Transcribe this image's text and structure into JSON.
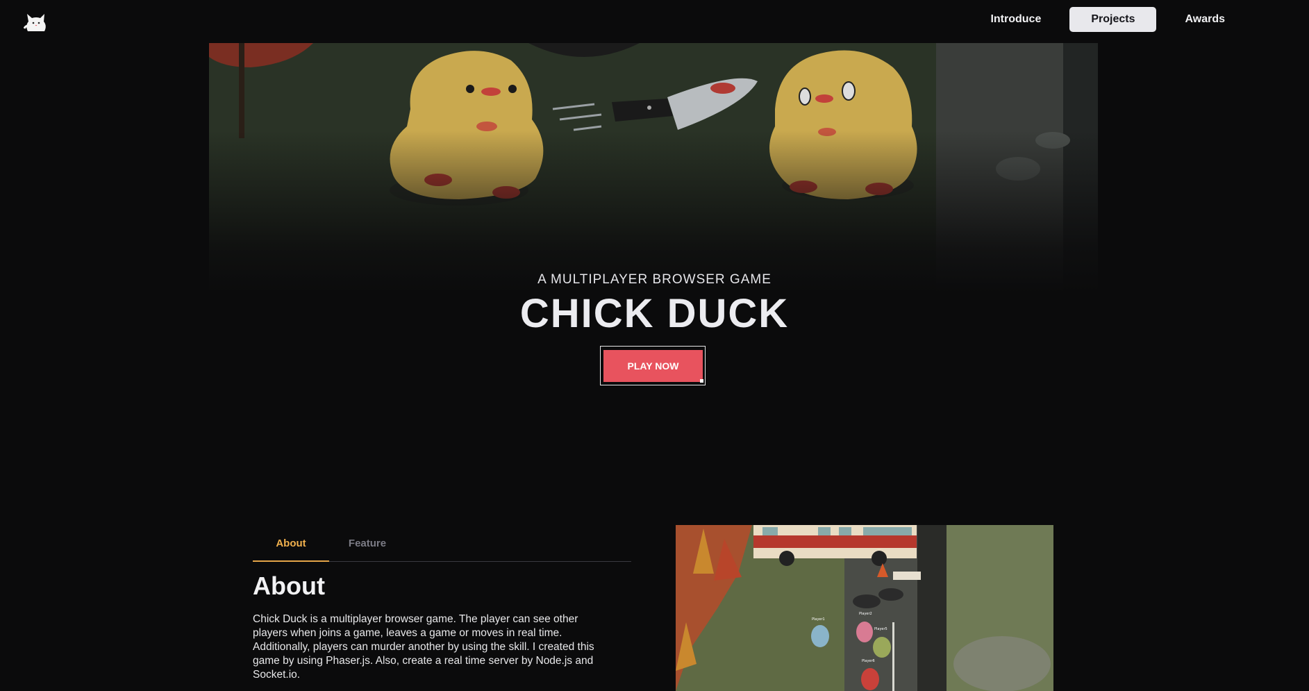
{
  "nav": {
    "links": [
      {
        "label": "Introduce"
      },
      {
        "label": "Projects"
      },
      {
        "label": "Awards"
      }
    ]
  },
  "hero": {
    "subtitle": "A MULTIPLAYER BROWSER GAME",
    "title": "CHICK DUCK",
    "play_label": "PLAY NOW"
  },
  "tabs": [
    {
      "label": "About"
    },
    {
      "label": "Feature"
    }
  ],
  "about": {
    "heading": "About",
    "text": "Chick Duck is a multiplayer browser game. The player can see other players when joins a game, leaves a game or moves in real time. Additionally, players can murder another by using the skill. I created this game by using Phaser.js. Also, create a real time server by Node.js and Socket.io."
  },
  "game_screenshot": {
    "players": [
      "Player1",
      "Player2",
      "Player5",
      "Player6"
    ]
  },
  "colors": {
    "background": "#0b0b0c",
    "accent_tab": "#e5a548",
    "play_button": "#e8535e",
    "nav_active_bg": "#e8e8ec"
  }
}
